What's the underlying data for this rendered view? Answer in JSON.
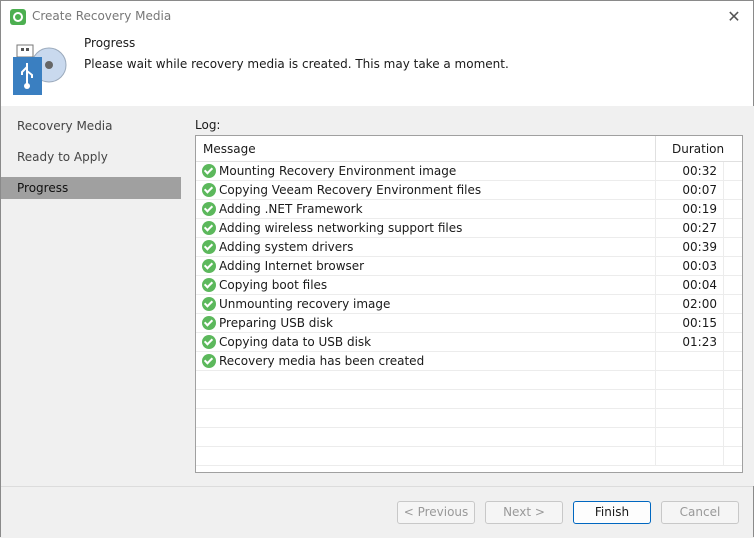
{
  "window": {
    "title": "Create Recovery Media",
    "close_icon": "close-icon",
    "app_icon": "veeam-icon"
  },
  "header": {
    "title": "Progress",
    "subtitle": "Please wait while recovery media is created. This may take a moment."
  },
  "sidebar": {
    "items": [
      {
        "label": "Recovery Media"
      },
      {
        "label": "Ready to Apply"
      },
      {
        "label": "Progress",
        "selected": true
      }
    ]
  },
  "log": {
    "label": "Log:",
    "columns": [
      "Message",
      "Duration"
    ],
    "rows": [
      {
        "message": "Mounting Recovery Environment image",
        "duration": "00:32"
      },
      {
        "message": "Copying Veeam Recovery Environment files",
        "duration": "00:07"
      },
      {
        "message": "Adding .NET Framework",
        "duration": "00:19"
      },
      {
        "message": "Adding wireless networking support files",
        "duration": "00:27"
      },
      {
        "message": "Adding system drivers",
        "duration": "00:39"
      },
      {
        "message": "Adding Internet browser",
        "duration": "00:03"
      },
      {
        "message": "Copying boot files",
        "duration": "00:04"
      },
      {
        "message": "Unmounting recovery image",
        "duration": "02:00"
      },
      {
        "message": "Preparing USB disk",
        "duration": "00:15"
      },
      {
        "message": "Copying data to USB disk",
        "duration": "01:23"
      },
      {
        "message": "Recovery media has been created",
        "duration": ""
      }
    ]
  },
  "footer": {
    "previous": "< Previous",
    "next": "Next >",
    "finish": "Finish",
    "cancel": "Cancel"
  }
}
